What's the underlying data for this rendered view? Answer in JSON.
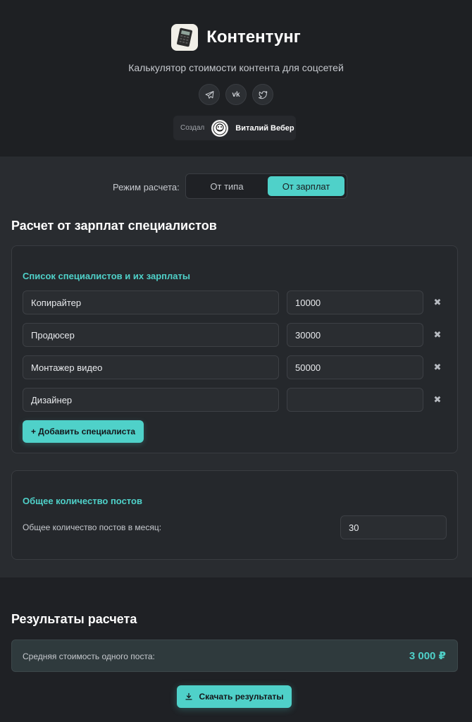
{
  "header": {
    "title": "Контентунг",
    "subtitle": "Калькулятор стоимости контента для соцсетей",
    "socials": [
      "telegram-icon",
      "vk-icon",
      "twitter-icon"
    ],
    "author_label": "Создал",
    "author_name": "Виталий Вебер"
  },
  "mode": {
    "label": "Режим расчета:",
    "options": [
      "От типа",
      "От зарплат"
    ],
    "selected": "От зарплат"
  },
  "section_title": "Расчет от зарплат специалистов",
  "specialists": {
    "title": "Список специалистов и их зарплаты",
    "rows": [
      {
        "name": "Копирайтер",
        "salary": "10000"
      },
      {
        "name": "Продюсер",
        "salary": "30000"
      },
      {
        "name": "Монтажер видео",
        "salary": "50000"
      },
      {
        "name": "Дизайнер",
        "salary": ""
      }
    ],
    "add_label": "+ Добавить специалиста"
  },
  "posts": {
    "title": "Общее количество постов",
    "label": "Общее количество постов в месяц:",
    "value": "30"
  },
  "results": {
    "title": "Результаты расчета",
    "avg_label": "Средняя стоимость одного поста:",
    "avg_value": "3 000 ₽",
    "download_label": "Скачать результаты"
  },
  "colors": {
    "accent": "#4fd1c9",
    "background": "#1f2125",
    "panel": "#292c30"
  }
}
